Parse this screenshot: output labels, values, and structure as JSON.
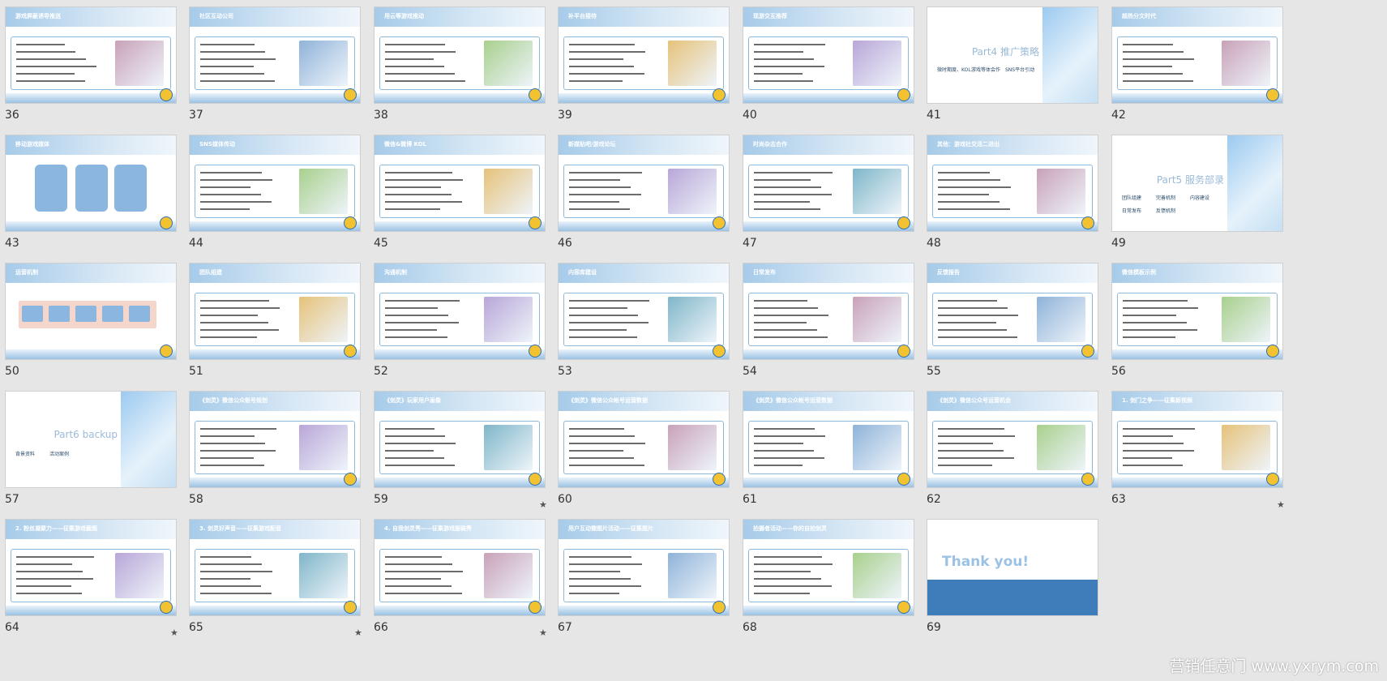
{
  "slides": [
    {
      "num": "36",
      "title": "游戏屏蔽诱导推送",
      "type": "content",
      "star": false
    },
    {
      "num": "37",
      "title": "社区互动公司",
      "type": "content",
      "star": false
    },
    {
      "num": "38",
      "title": "用云等游戏推动",
      "type": "content",
      "star": false
    },
    {
      "num": "39",
      "title": "补平台接待",
      "type": "content",
      "star": false
    },
    {
      "num": "40",
      "title": "现游交互推荐",
      "type": "content",
      "star": false
    },
    {
      "num": "41",
      "title": "Part4 推广策略",
      "type": "part",
      "star": false,
      "subs": [
        "微时期度、KOL",
        "游戏等体会作",
        "SNS平台引动"
      ]
    },
    {
      "num": "42",
      "title": "超热分文时代",
      "type": "content",
      "star": false
    },
    {
      "num": "43",
      "title": "移动游戏媒体",
      "type": "blocks",
      "star": false
    },
    {
      "num": "44",
      "title": "SNS媒体传动",
      "type": "content",
      "star": false
    },
    {
      "num": "45",
      "title": "微信&微博 KOL",
      "type": "content",
      "star": false
    },
    {
      "num": "46",
      "title": "新媒贴吧/游戏论坛",
      "type": "content",
      "star": false
    },
    {
      "num": "47",
      "title": "时尚杂志合作",
      "type": "content",
      "star": false
    },
    {
      "num": "48",
      "title": "其他：游戏社交活二进出",
      "type": "content",
      "star": false
    },
    {
      "num": "49",
      "title": "Part5 服务部录",
      "type": "part",
      "star": false,
      "subs": [
        "团队组建",
        "完善机制",
        "内容建设",
        "日常发布",
        "反馈机制"
      ]
    },
    {
      "num": "50",
      "title": "运营机制",
      "type": "flow",
      "star": false
    },
    {
      "num": "51",
      "title": "团队组建",
      "type": "content",
      "star": false
    },
    {
      "num": "52",
      "title": "沟通机制",
      "type": "content",
      "star": false
    },
    {
      "num": "53",
      "title": "内容库建设",
      "type": "content",
      "star": false
    },
    {
      "num": "54",
      "title": "日常发布",
      "type": "content",
      "star": false
    },
    {
      "num": "55",
      "title": "反馈报告",
      "type": "content",
      "star": false
    },
    {
      "num": "56",
      "title": "微信模板示例",
      "type": "content",
      "star": false
    },
    {
      "num": "57",
      "title": "Part6 backup",
      "type": "part",
      "star": false,
      "subs": [
        "背景资料",
        "活动案例"
      ]
    },
    {
      "num": "58",
      "title": "《剑灵》微信公众账号规划",
      "type": "content",
      "star": false
    },
    {
      "num": "59",
      "title": "《剑灵》玩家用户画像",
      "type": "content",
      "star": true
    },
    {
      "num": "60",
      "title": "《剑灵》微信公众帐号运营数据",
      "type": "content",
      "star": false
    },
    {
      "num": "61",
      "title": "《剑灵》微信公众帐号运营数据",
      "type": "content",
      "star": false
    },
    {
      "num": "62",
      "title": "《剑灵》微信公众号运营机会",
      "type": "content",
      "star": false
    },
    {
      "num": "63",
      "title": "1. 剑门之争——征集新视频",
      "type": "content",
      "star": true
    },
    {
      "num": "64",
      "title": "2. 粉丝凝聚力——征集游戏截图",
      "type": "content",
      "star": true
    },
    {
      "num": "65",
      "title": "3. 剑灵好声音——征集游戏配音",
      "type": "content",
      "star": true
    },
    {
      "num": "66",
      "title": "4. 自我剑灵秀——征集游戏服装秀",
      "type": "content",
      "star": true
    },
    {
      "num": "67",
      "title": "用户互动微图片活动——征集图片",
      "type": "content",
      "star": false
    },
    {
      "num": "68",
      "title": "拍摄者活动——你的自拍剑灵",
      "type": "content",
      "star": false
    },
    {
      "num": "69",
      "title": "Thank you!",
      "type": "thanks",
      "star": false
    }
  ],
  "watermark": "营销任意门 www.yxrym.com",
  "colors": {
    "accent": "#8ab6df",
    "header": "#a6cbe9",
    "logo": "#f2c230"
  }
}
